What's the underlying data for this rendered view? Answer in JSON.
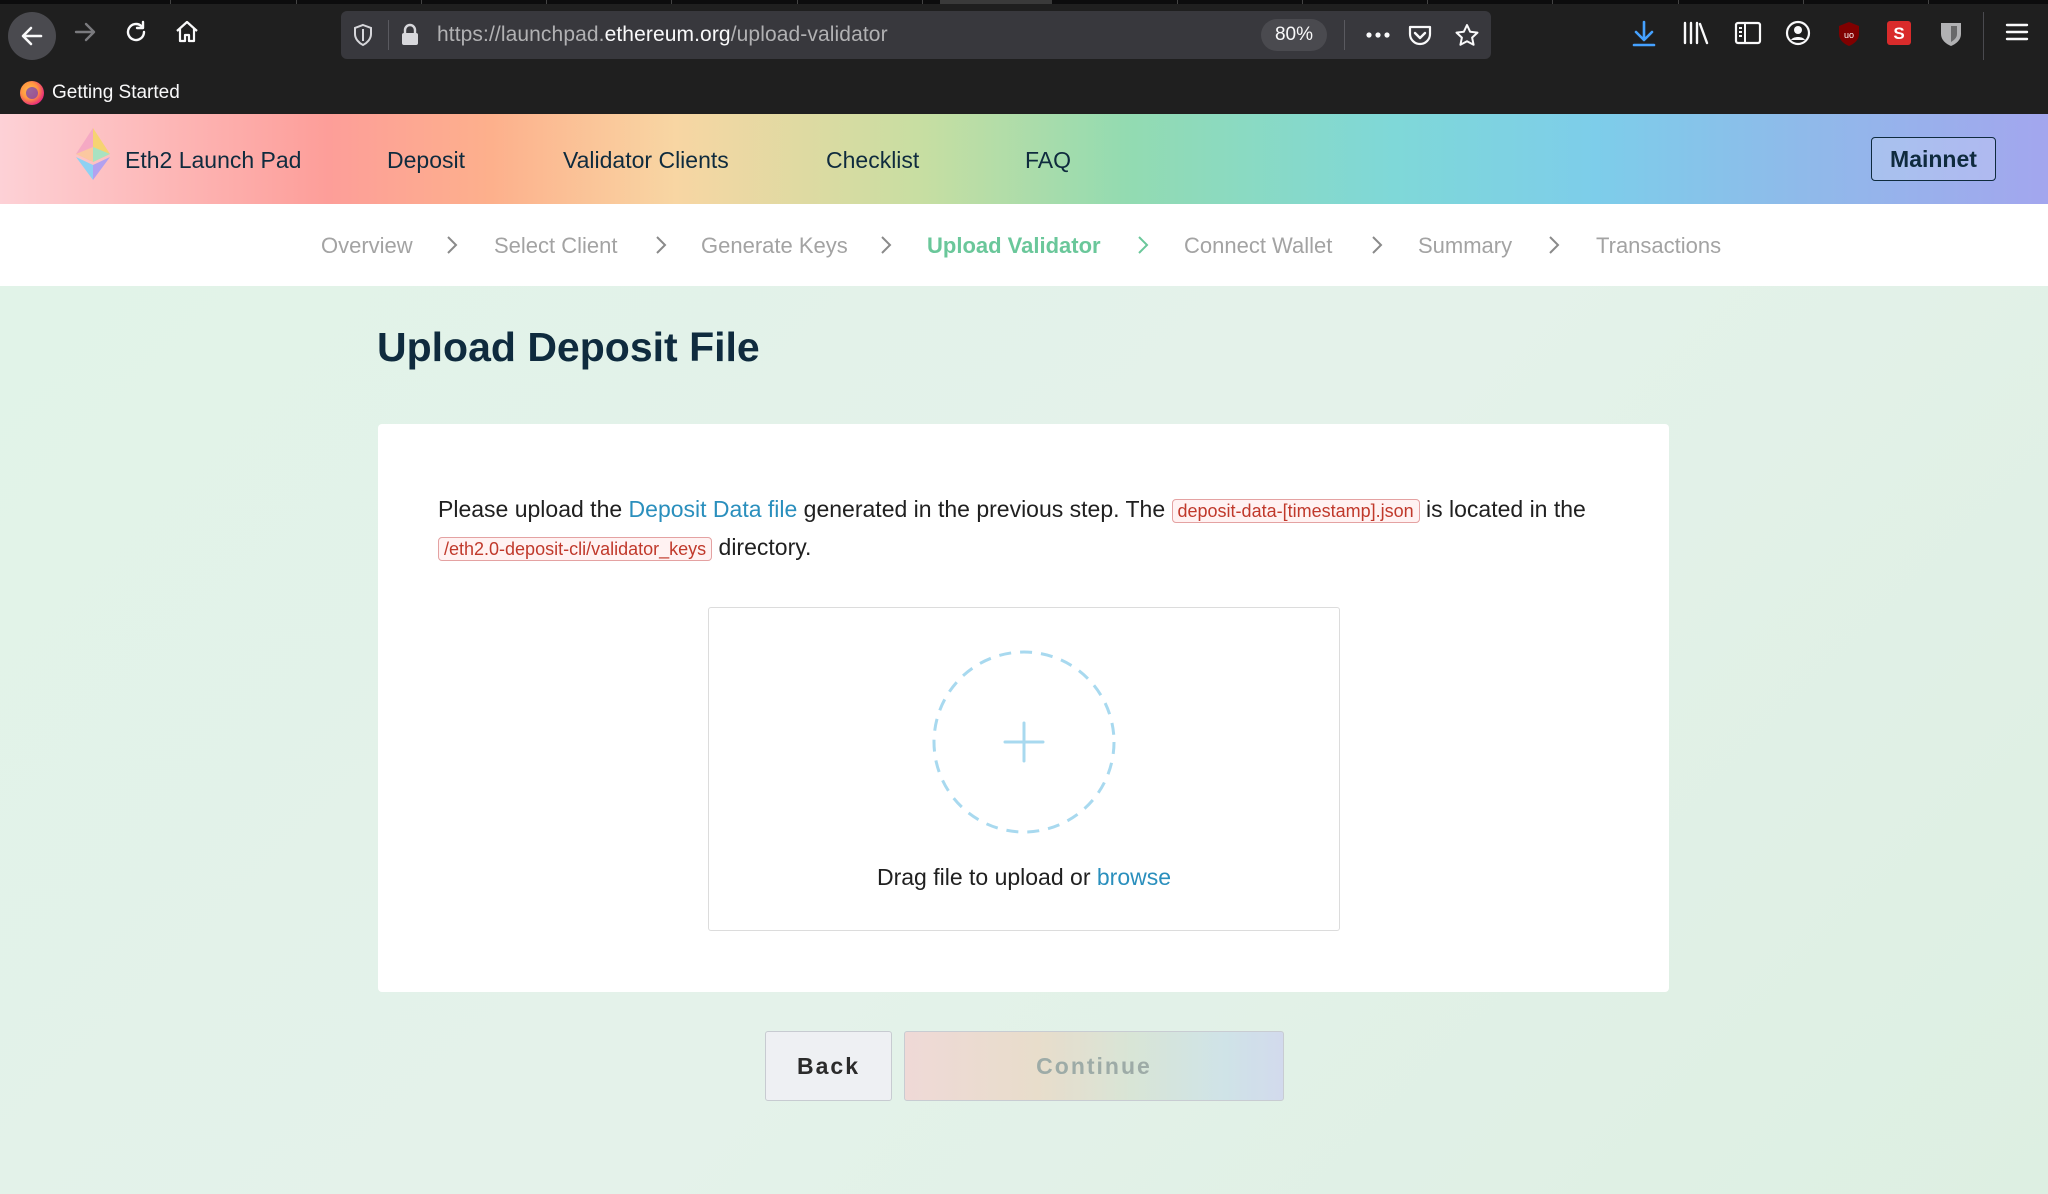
{
  "browser": {
    "url_prefix": "https://launchpad.",
    "url_domain": "ethereum.org",
    "url_path": "/upload-validator",
    "zoom": "80%",
    "bookmarks": [
      {
        "label": "Getting Started"
      }
    ]
  },
  "header": {
    "brand": "Eth2 Launch Pad",
    "nav": [
      "Deposit",
      "Validator Clients",
      "Checklist",
      "FAQ"
    ],
    "network_button": "Mainnet"
  },
  "stepper": {
    "steps": [
      "Overview",
      "Select Client",
      "Generate Keys",
      "Upload Validator",
      "Connect Wallet",
      "Summary",
      "Transactions"
    ],
    "active_index": 3
  },
  "main": {
    "title": "Upload Deposit File",
    "instruction": {
      "part1": "Please upload the ",
      "link": "Deposit Data file",
      "part2": " generated in the previous step. The ",
      "code1": "deposit-data-[timestamp].json",
      "part3": " is located in the ",
      "code2": "/eth2.0-deposit-cli/validator_keys",
      "part4": " directory."
    },
    "dropzone": {
      "text": "Drag file to upload or ",
      "link": "browse"
    },
    "buttons": {
      "back": "Back",
      "continue": "Continue"
    }
  },
  "colors": {
    "accent_link": "#2a8fbd",
    "active_step": "#6ac79a",
    "title": "#0f2b3e"
  }
}
